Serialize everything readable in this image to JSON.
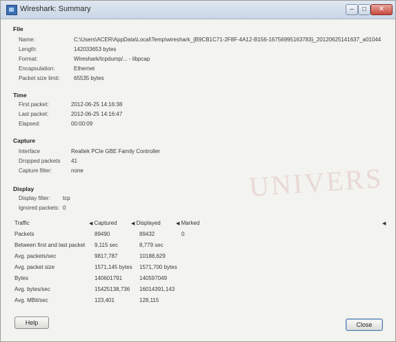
{
  "window": {
    "title": "Wireshark: Summary"
  },
  "sections": {
    "file": {
      "heading": "File",
      "rows": [
        {
          "key": "Name:",
          "value": "C:\\Users\\ACER\\AppData\\Local\\Temp\\wireshark_{B9CB1C71-2F8F-4A12-B156-16756995163783}_20120625141637_a01044"
        },
        {
          "key": "Length:",
          "value": "142033653 bytes"
        },
        {
          "key": "Format:",
          "value": "Wireshark/tcpdump/... - libpcap"
        },
        {
          "key": "Encapsulation:",
          "value": "Ethernet"
        },
        {
          "key": "Packet size limit:",
          "value": "65535 bytes"
        }
      ]
    },
    "time": {
      "heading": "Time",
      "rows": [
        {
          "key": "First packet:",
          "value": "2012-06-25 14:16:38"
        },
        {
          "key": "Last packet:",
          "value": "2012-06-25 14:16:47"
        },
        {
          "key": "Elapsed:",
          "value": "00:00:09"
        }
      ]
    },
    "capture": {
      "heading": "Capture",
      "rows": [
        {
          "key": "Interface",
          "value": "Realtek PCIe GBE Family Controller"
        },
        {
          "key": "Dropped packets",
          "value": "41"
        },
        {
          "key": "Capture filter:",
          "value": "none"
        }
      ]
    },
    "display": {
      "heading": "Display",
      "rows": [
        {
          "key": "Display filter:",
          "value": "tcp"
        },
        {
          "key": "Ignored packets:",
          "value": "0"
        }
      ]
    }
  },
  "traffic": {
    "headers": {
      "traffic": "Traffic",
      "captured": "Captured",
      "displayed": "Displayed",
      "marked": "Marked"
    },
    "rows": [
      {
        "label": "Packets",
        "captured": "89490",
        "displayed": "89432",
        "marked": "0"
      },
      {
        "label": "Between first and last packet",
        "captured": "9,115 sec",
        "displayed": "8,779 sec",
        "marked": ""
      },
      {
        "label": "Avg. packets/sec",
        "captured": "9817,787",
        "displayed": "10188,629",
        "marked": ""
      },
      {
        "label": "Avg. packet size",
        "captured": "1571,145 bytes",
        "displayed": "1571,700 bytes",
        "marked": ""
      },
      {
        "label": "Bytes",
        "captured": "140601791",
        "displayed": "140597049",
        "marked": ""
      },
      {
        "label": "Avg. bytes/sec",
        "captured": "15425138,736",
        "displayed": "16014391,143",
        "marked": ""
      },
      {
        "label": "Avg. MBit/sec",
        "captured": "123,401",
        "displayed": "128,115",
        "marked": ""
      }
    ]
  },
  "buttons": {
    "help": "Help",
    "close": "Close"
  },
  "watermark": "UNIVERS"
}
